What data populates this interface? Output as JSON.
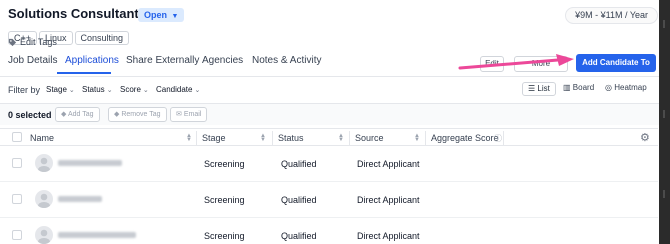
{
  "job": {
    "title": "Solutions Consultant",
    "status": "Open",
    "salary": "¥9M - ¥11M / Year",
    "tags": [
      "C++",
      "Linux",
      "Consulting"
    ],
    "edit_tags_label": "Edit Tags"
  },
  "tabs": [
    {
      "label": "Job Details",
      "active": false
    },
    {
      "label": "Applications",
      "active": true
    },
    {
      "label": "Share Externally",
      "active": false
    },
    {
      "label": "Agencies",
      "active": false
    },
    {
      "label": "Notes & Activity",
      "active": false
    }
  ],
  "actions": {
    "edit_label": "Edit",
    "more_label": "More",
    "add_candidate_label": "Add Candidate To Job"
  },
  "filters": {
    "label": "Filter by",
    "items": [
      "Stage",
      "Status",
      "Score",
      "Candidate"
    ]
  },
  "views": {
    "list": "List",
    "board": "Board",
    "heatmap": "Heatmap",
    "active": "List"
  },
  "toolbar": {
    "selected": "0 selected",
    "add_tag": "Add Tag",
    "remove_tag": "Remove Tag",
    "email": "Email"
  },
  "table": {
    "columns": [
      "Name",
      "Stage",
      "Status",
      "Source",
      "Aggregate Score"
    ],
    "rows": [
      {
        "stage": "Screening",
        "status": "Qualified",
        "source": "Direct Applicant"
      },
      {
        "stage": "Screening",
        "status": "Qualified",
        "source": "Direct Applicant"
      },
      {
        "stage": "Screening",
        "status": "Qualified",
        "source": "Direct Applicant"
      }
    ]
  },
  "colors": {
    "accent": "#2563eb",
    "arrow": "#ec4899"
  }
}
